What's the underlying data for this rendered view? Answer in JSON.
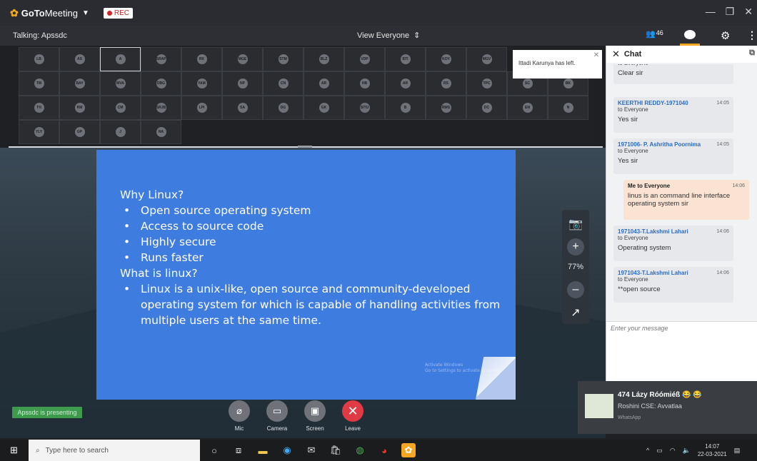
{
  "app": {
    "name_bold": "GoTo",
    "name_light": "Meeting",
    "rec_label": "REC",
    "win_controls": [
      "—",
      "❐",
      "✕"
    ]
  },
  "subbar": {
    "talking": "Talking: Apssdc",
    "view_label": "View Everyone",
    "people_count": "46"
  },
  "grid": {
    "initials": [
      "LB",
      "AS",
      "A",
      "SRAP",
      "RK",
      "MGE",
      "STM",
      "BLZ",
      "VDP",
      "BTI",
      "KOY",
      "MGV",
      "",
      "",
      "TM",
      "BAY",
      "MVA",
      "DBG",
      "YAM",
      "NP",
      "CN",
      "AR",
      "HB",
      "AR",
      "RS",
      "TPC",
      "SC",
      "BK",
      "TH",
      "RM",
      "CM",
      "SRJB",
      "LPI",
      "SA",
      "DG",
      "GK",
      "SITU",
      "B",
      "RMS",
      "DC",
      "EN",
      "N",
      "YLY",
      "GP",
      "J",
      "NA",
      "",
      "",
      "",
      "",
      "",
      "",
      "",
      "",
      "",
      ""
    ],
    "active_index": 2,
    "toast": "Ittadi Karunya has left."
  },
  "slide": {
    "heading1": "Why Linux?",
    "bullets1": [
      "Open source operating system",
      "Access to source code",
      "Highly secure",
      "Runs faster"
    ],
    "heading2": "What is linux?",
    "bullets2": [
      "Linux is a unix-like, open source and community-developed operating system for which is capable of handling activities from multiple users at the same time."
    ],
    "watermark_line1": "Activate Windows",
    "watermark_line2": "Go to Settings to activate Windows."
  },
  "zoom": {
    "percent": "77%"
  },
  "presenting": "Apssdc is presenting",
  "controls": [
    {
      "label": "Mic",
      "icon": "mic-off-icon",
      "glyph": "⌀"
    },
    {
      "label": "Camera",
      "icon": "camera-off-icon",
      "glyph": "▭"
    },
    {
      "label": "Screen",
      "icon": "screen-share-icon",
      "glyph": "▣"
    },
    {
      "label": "Leave",
      "icon": "leave-icon",
      "glyph": "✕"
    }
  ],
  "chat": {
    "title": "Chat",
    "messages": [
      {
        "name": "",
        "to": "to Everyone",
        "time": "",
        "text": "Clear sir"
      },
      {
        "name": "KEERTHI REDDY-1971040",
        "to": "to Everyone",
        "time": "14:05",
        "text": "Yes sir"
      },
      {
        "name": "1971006- P. Ashritha Poornima",
        "to": "to Everyone",
        "time": "14:05",
        "text": "Yes sir"
      },
      {
        "name": "Me to Everyone",
        "to": "",
        "time": "14:06",
        "text": "linus is an command line interface operating system sir"
      },
      {
        "name": "1971043-T.Lakshmi Lahari",
        "to": "to Everyone",
        "time": "14:06",
        "text": "Operating system"
      },
      {
        "name": "1971043-T.Lakshmi Lahari",
        "to": "to Everyone",
        "time": "14:06",
        "text": "**open source"
      }
    ],
    "input_placeholder": "Enter your message"
  },
  "notification": {
    "title": "474 Lázy Róómiéß 😂 😂",
    "subtitle": "Roshini CSE: Avvatlaa",
    "source": "WhatsApp"
  },
  "taskbar": {
    "search_placeholder": "Type here to search",
    "time": "14:07",
    "date": "22-03-2021"
  }
}
